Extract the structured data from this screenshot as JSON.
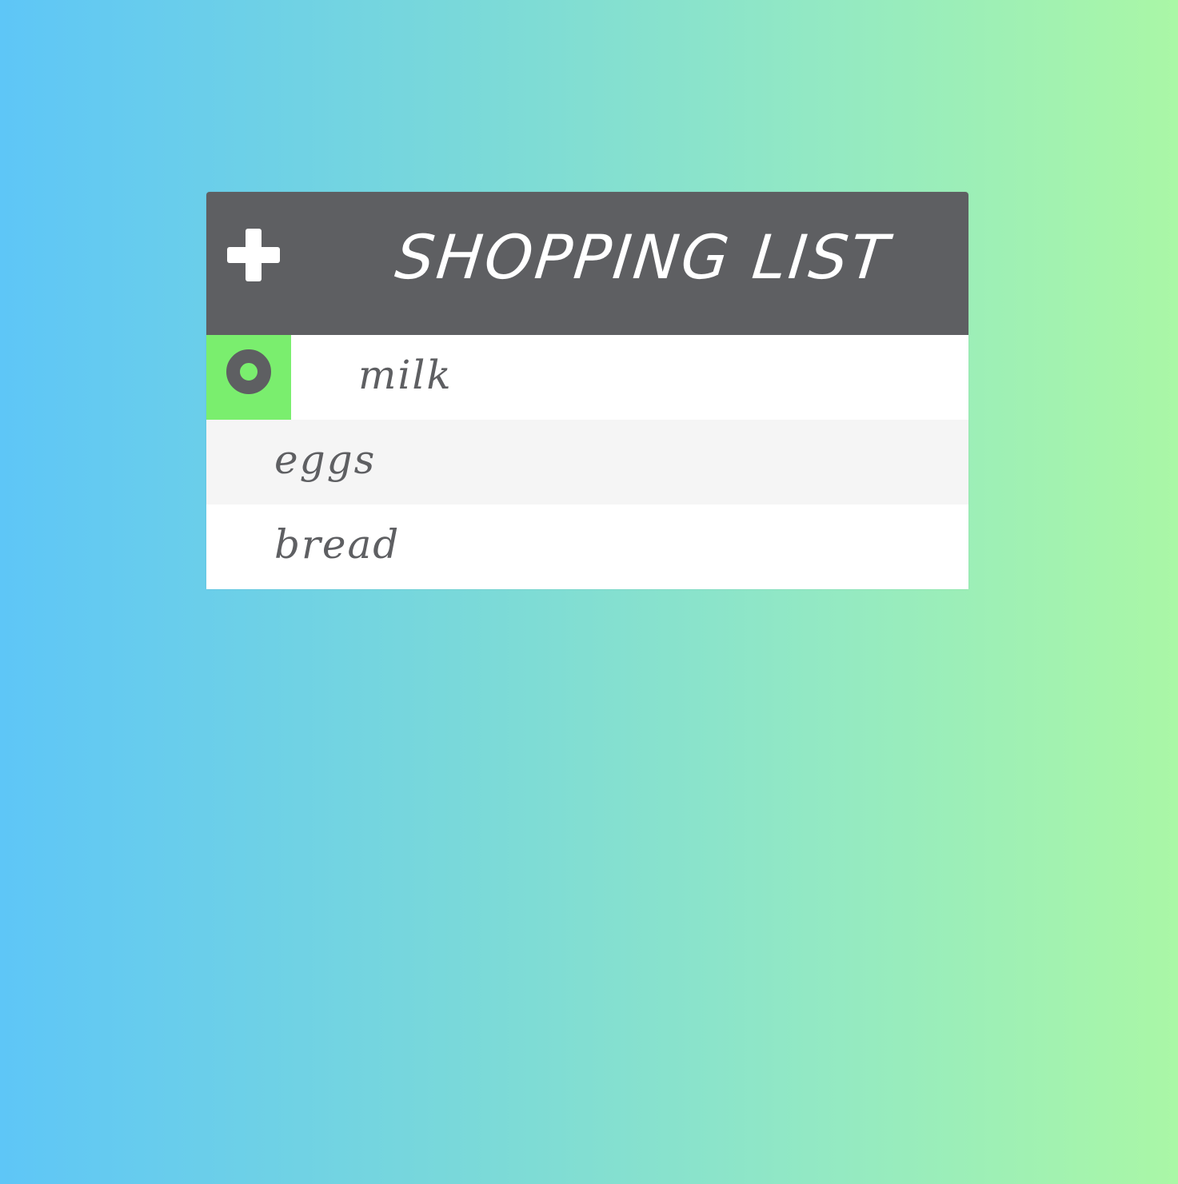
{
  "header": {
    "title": "SHOPPING LIST",
    "add_icon": "plus-icon"
  },
  "items": [
    {
      "label": "milk",
      "selected": true,
      "status_icon": "radio-circle-icon"
    },
    {
      "label": "eggs",
      "selected": false
    },
    {
      "label": "bread",
      "selected": false
    }
  ],
  "colors": {
    "header_bg": "#5e5f62",
    "accent_green": "#7aee6e",
    "text": "#5e5f62",
    "gradient_start": "#5ec6f7",
    "gradient_end": "#aaf7a6"
  }
}
